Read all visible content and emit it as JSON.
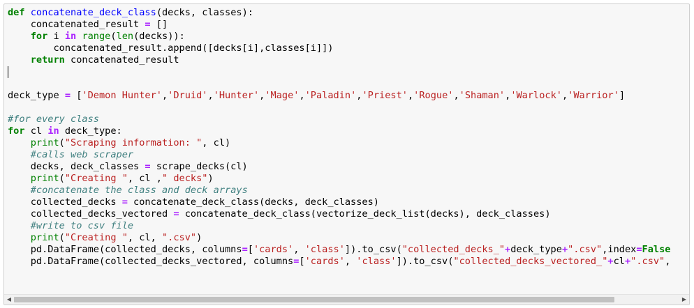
{
  "cell": {
    "code_lines": [
      [
        [
          "kw",
          "def"
        ],
        [
          "t",
          " "
        ],
        [
          "fn",
          "concatenate_deck_class"
        ],
        [
          "t",
          "(decks, classes):"
        ]
      ],
      [
        [
          "t",
          "    concatenated_result "
        ],
        [
          "op",
          "="
        ],
        [
          "t",
          " []"
        ]
      ],
      [
        [
          "t",
          "    "
        ],
        [
          "kw",
          "for"
        ],
        [
          "t",
          " i "
        ],
        [
          "op",
          "in"
        ],
        [
          "t",
          " "
        ],
        [
          "bi",
          "range"
        ],
        [
          "t",
          "("
        ],
        [
          "bi",
          "len"
        ],
        [
          "t",
          "(decks)):"
        ]
      ],
      [
        [
          "t",
          "        concatenated_result.append([decks[i],classes[i]])"
        ]
      ],
      [
        [
          "t",
          "    "
        ],
        [
          "kw",
          "return"
        ],
        [
          "t",
          " concatenated_result"
        ]
      ],
      [
        [
          "cursor",
          ""
        ]
      ],
      [],
      [
        [
          "t",
          "deck_type "
        ],
        [
          "op",
          "="
        ],
        [
          "t",
          " ["
        ],
        [
          "str",
          "'Demon Hunter'"
        ],
        [
          "t",
          ","
        ],
        [
          "str",
          "'Druid'"
        ],
        [
          "t",
          ","
        ],
        [
          "str",
          "'Hunter'"
        ],
        [
          "t",
          ","
        ],
        [
          "str",
          "'Mage'"
        ],
        [
          "t",
          ","
        ],
        [
          "str",
          "'Paladin'"
        ],
        [
          "t",
          ","
        ],
        [
          "str",
          "'Priest'"
        ],
        [
          "t",
          ","
        ],
        [
          "str",
          "'Rogue'"
        ],
        [
          "t",
          ","
        ],
        [
          "str",
          "'Shaman'"
        ],
        [
          "t",
          ","
        ],
        [
          "str",
          "'Warlock'"
        ],
        [
          "t",
          ","
        ],
        [
          "str",
          "'Warrior'"
        ],
        [
          "t",
          "]"
        ]
      ],
      [],
      [
        [
          "cm",
          "#for every class"
        ]
      ],
      [
        [
          "kw",
          "for"
        ],
        [
          "t",
          " cl "
        ],
        [
          "op",
          "in"
        ],
        [
          "t",
          " deck_type:"
        ]
      ],
      [
        [
          "t",
          "    "
        ],
        [
          "bi",
          "print"
        ],
        [
          "t",
          "("
        ],
        [
          "str",
          "\"Scraping information: \""
        ],
        [
          "t",
          ", cl)"
        ]
      ],
      [
        [
          "t",
          "    "
        ],
        [
          "cm",
          "#calls web scraper"
        ]
      ],
      [
        [
          "t",
          "    decks, deck_classes "
        ],
        [
          "op",
          "="
        ],
        [
          "t",
          " scrape_decks(cl)"
        ]
      ],
      [
        [
          "t",
          "    "
        ],
        [
          "bi",
          "print"
        ],
        [
          "t",
          "("
        ],
        [
          "str",
          "\"Creating \""
        ],
        [
          "t",
          ", cl ,"
        ],
        [
          "str",
          "\" decks\""
        ],
        [
          "t",
          ")"
        ]
      ],
      [
        [
          "t",
          "    "
        ],
        [
          "cm",
          "#concatenate the class and deck arrays"
        ]
      ],
      [
        [
          "t",
          "    collected_decks "
        ],
        [
          "op",
          "="
        ],
        [
          "t",
          " concatenate_deck_class(decks, deck_classes)"
        ]
      ],
      [
        [
          "t",
          "    collected_decks_vectored "
        ],
        [
          "op",
          "="
        ],
        [
          "t",
          " concatenate_deck_class(vectorize_deck_list(decks), deck_classes)"
        ]
      ],
      [
        [
          "t",
          "    "
        ],
        [
          "cm",
          "#write to csv file"
        ]
      ],
      [
        [
          "t",
          "    "
        ],
        [
          "bi",
          "print"
        ],
        [
          "t",
          "("
        ],
        [
          "str",
          "\"Creating \""
        ],
        [
          "t",
          ", cl, "
        ],
        [
          "str",
          "\".csv\""
        ],
        [
          "t",
          ")"
        ]
      ],
      [
        [
          "t",
          "    pd.DataFrame(collected_decks, columns"
        ],
        [
          "op",
          "="
        ],
        [
          "t",
          "["
        ],
        [
          "str",
          "'cards'"
        ],
        [
          "t",
          ", "
        ],
        [
          "str",
          "'class'"
        ],
        [
          "t",
          "]).to_csv("
        ],
        [
          "str",
          "\"collected_decks_\""
        ],
        [
          "op",
          "+"
        ],
        [
          "t",
          "deck_type"
        ],
        [
          "op",
          "+"
        ],
        [
          "str",
          "\".csv\""
        ],
        [
          "t",
          ",index"
        ],
        [
          "op",
          "="
        ],
        [
          "kw",
          "False"
        ]
      ],
      [
        [
          "t",
          "    pd.DataFrame(collected_decks_vectored, columns"
        ],
        [
          "op",
          "="
        ],
        [
          "t",
          "["
        ],
        [
          "str",
          "'cards'"
        ],
        [
          "t",
          ", "
        ],
        [
          "str",
          "'class'"
        ],
        [
          "t",
          "]).to_csv("
        ],
        [
          "str",
          "\"collected_decks_vectored_\""
        ],
        [
          "op",
          "+"
        ],
        [
          "t",
          "cl"
        ],
        [
          "op",
          "+"
        ],
        [
          "str",
          "\".csv\""
        ],
        [
          "t",
          ","
        ]
      ]
    ]
  },
  "scrollbar": {
    "left_arrow": "◀",
    "right_arrow": "▶"
  }
}
